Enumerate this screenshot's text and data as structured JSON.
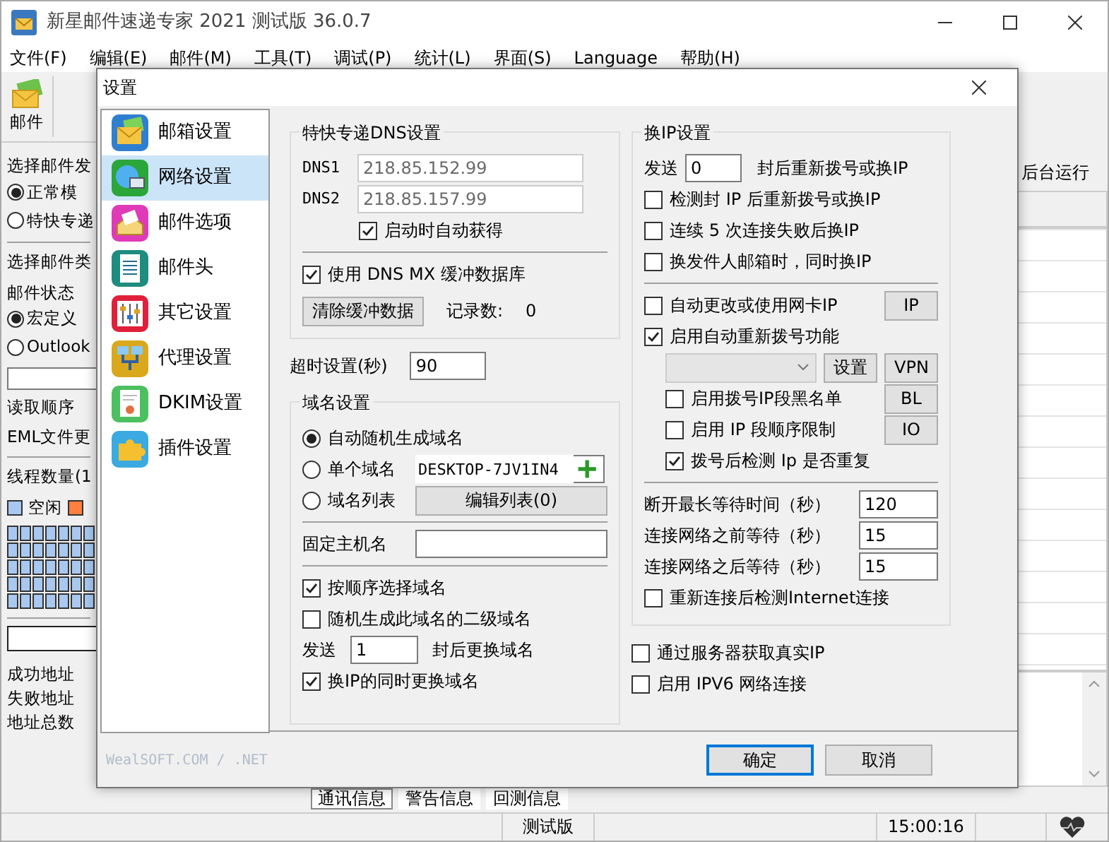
{
  "window": {
    "title": "新星邮件速递专家 2021 测试版 36.0.7"
  },
  "menu": [
    "文件(F)",
    "编辑(E)",
    "邮件(M)",
    "工具(T)",
    "调试(P)",
    "统计(L)",
    "界面(S)",
    "Language",
    "帮助(H)"
  ],
  "toolbar": [
    {
      "label": "邮件"
    }
  ],
  "left_panel": {
    "send_mode_label": "选择邮件发",
    "send_modes": [
      {
        "label": "正常模",
        "selected": true
      },
      {
        "label": "特快专递",
        "selected": false
      }
    ],
    "mail_type_label": "选择邮件类",
    "mail_status_label": "邮件状态",
    "sources": [
      {
        "label": "宏定义",
        "selected": true
      },
      {
        "label": "Outlook",
        "selected": false
      }
    ],
    "read_order_label": "读取顺序",
    "eml_label": "EML文件更",
    "threads_label": "线程数量(1",
    "legend": [
      {
        "label": "空闲",
        "color": "#a8c8f0"
      },
      {
        "color": "#ff7f3f"
      }
    ],
    "stats": [
      "成功地址",
      "失败地址",
      "地址总数"
    ]
  },
  "right_panel": {
    "background_run": "后台运行"
  },
  "log_tabs": [
    {
      "label": "通讯信息",
      "selected": true
    },
    {
      "label": "警告信息",
      "selected": false
    },
    {
      "label": "回测信息",
      "selected": false
    }
  ],
  "status_bar": {
    "edition": "测试版",
    "time": "15:00:16"
  },
  "dialog": {
    "title": "设置",
    "nav": [
      {
        "label": "邮箱设置",
        "selected": false
      },
      {
        "label": "网络设置",
        "selected": true
      },
      {
        "label": "邮件选项",
        "selected": false
      },
      {
        "label": "邮件头",
        "selected": false
      },
      {
        "label": "其它设置",
        "selected": false
      },
      {
        "label": "代理设置",
        "selected": false
      },
      {
        "label": "DKIM设置",
        "selected": false
      },
      {
        "label": "插件设置",
        "selected": false
      }
    ],
    "footer_text": "WealSOFT.COM / .NET",
    "dns_group": {
      "title": "特快专递DNS设置",
      "servers": [
        {
          "label": "DNS1",
          "value": "218.85.152.99",
          "disabled": true
        },
        {
          "label": "DNS2",
          "value": "218.85.157.99",
          "disabled": true
        }
      ],
      "auto_obtain": {
        "label": "启动时自动获得",
        "checked": true
      },
      "use_cache": {
        "label": "使用 DNS MX 缓冲数据库",
        "checked": true
      },
      "clear_button": "清除缓冲数据",
      "record_count_label": "记录数:",
      "record_count": "0"
    },
    "timeout": {
      "label": "超时设置(秒)",
      "value": "90"
    },
    "domain_group": {
      "title": "域名设置",
      "modes": [
        {
          "label": "自动随机生成域名",
          "selected": true
        },
        {
          "label": "单个域名",
          "selected": false
        },
        {
          "label": "域名列表",
          "selected": false
        }
      ],
      "single_domain": "DESKTOP-7JV1IN4",
      "edit_list_button": "编辑列表(0)",
      "fixed_host_label": "固定主机名",
      "options": [
        {
          "kind": "check",
          "label": "按顺序选择域名",
          "checked": true
        },
        {
          "kind": "check",
          "label": "随机生成此域名的二级域名",
          "checked": false
        },
        {
          "kind": "count",
          "prefix": "发送",
          "value": "1",
          "suffix": "封后更换域名"
        },
        {
          "kind": "check",
          "label": "换IP的同时更换域名",
          "checked": true
        }
      ]
    },
    "ip_group": {
      "title": "换IP设置",
      "send_count": {
        "prefix": "发送",
        "value": "0",
        "suffix": "封后重新拨号或换IP"
      },
      "checks": [
        {
          "label": "检测封 IP 后重新拨号或换IP",
          "checked": false
        },
        {
          "label": "连续 5 次连接失败后换IP",
          "checked": false
        },
        {
          "label": "换发件人邮箱时，同时换IP",
          "checked": false
        }
      ],
      "auto_nic": {
        "label": "自动更改或使用网卡IP",
        "checked": false,
        "button": "IP"
      },
      "redial": {
        "label": "启用自动重新拨号功能",
        "checked": true
      },
      "settings_button": "设置",
      "vpn_button": "VPN",
      "dial_options": [
        {
          "label": "启用拨号IP段黑名单",
          "checked": false,
          "button": "BL"
        },
        {
          "label": "启用 IP 段顺序限制",
          "checked": false,
          "button": "IO"
        },
        {
          "label": "拨号后检测 Ip 是否重复",
          "checked": true
        }
      ],
      "waits": [
        {
          "label": "断开最长等待时间（秒）",
          "value": "120"
        },
        {
          "label": "连接网络之前等待（秒）",
          "value": "15"
        },
        {
          "label": "连接网络之后等待（秒）",
          "value": "15"
        }
      ],
      "recheck": {
        "label": "重新连接后检测Internet连接",
        "checked": false
      }
    },
    "extra_checks": [
      {
        "label": "通过服务器获取真实IP",
        "checked": false
      },
      {
        "label": "启用 IPV6 网络连接",
        "checked": false
      }
    ],
    "buttons": [
      {
        "label": "确定",
        "default": true
      },
      {
        "label": "取消",
        "default": false
      }
    ]
  }
}
